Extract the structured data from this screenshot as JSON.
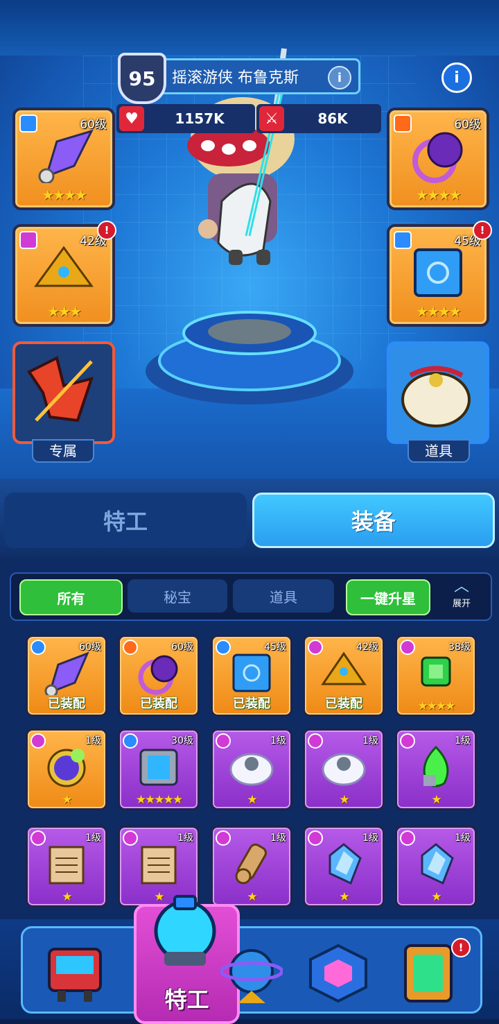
{
  "hero": {
    "level": "95",
    "name": "摇滚游侠 布鲁克斯",
    "info_icon": "i",
    "hp": "1157K",
    "atk": "86K"
  },
  "info_button": "i",
  "slots": {
    "left": [
      {
        "level": "60级",
        "stars": "★★★★",
        "icon": "crystal-sword-icon"
      },
      {
        "level": "42级",
        "stars": "★★★",
        "icon": "golden-pyramid-icon",
        "alert": "!"
      },
      {
        "tag": "专属",
        "icon": "broken-guitar-icon"
      }
    ],
    "right": [
      {
        "level": "60级",
        "stars": "★★★★",
        "icon": "purple-ring-icon"
      },
      {
        "level": "45级",
        "stars": "★★★★",
        "icon": "blue-cube-icon",
        "alert": "!"
      },
      {
        "tag": "道具",
        "icon": "bell-bag-icon"
      }
    ]
  },
  "tabs": {
    "agent": "特工",
    "equipment": "装备"
  },
  "filters": {
    "all": "所有",
    "treasure": "秘宝",
    "items": "道具",
    "upgrade_all": "一键升星",
    "expand": "展开"
  },
  "grid": [
    {
      "level": "60级",
      "status": "已装配",
      "color": "orange",
      "gem": "#2a8cff",
      "icon": "crystal-sword-icon"
    },
    {
      "level": "60级",
      "status": "已装配",
      "color": "orange",
      "gem": "#ff6a1a",
      "icon": "purple-ring-icon"
    },
    {
      "level": "45级",
      "status": "已装配",
      "color": "orange",
      "gem": "#2a8cff",
      "icon": "blue-cube-icon"
    },
    {
      "level": "42级",
      "status": "已装配",
      "color": "orange",
      "gem": "#d23ad6",
      "icon": "golden-pyramid-icon"
    },
    {
      "level": "38级",
      "stars": "★★★★",
      "color": "orange",
      "gem": "#d23ad6",
      "icon": "green-gem-icon"
    },
    {
      "level": "1级",
      "stars": "★",
      "color": "orange",
      "gem": "#d23ad6",
      "icon": "pocket-watch-icon"
    },
    {
      "level": "30级",
      "stars": "★★★★★",
      "color": "purple",
      "gem": "#2a8cff",
      "icon": "blue-frame-icon"
    },
    {
      "level": "1级",
      "stars": "★",
      "color": "purple",
      "gem": "#d23ad6",
      "icon": "fur-ring-icon"
    },
    {
      "level": "1级",
      "stars": "★",
      "color": "purple",
      "gem": "#d23ad6",
      "icon": "fur-ring-icon"
    },
    {
      "level": "1级",
      "stars": "★",
      "color": "purple",
      "gem": "#d23ad6",
      "icon": "green-flame-icon"
    },
    {
      "level": "1级",
      "stars": "★",
      "color": "purple",
      "gem": "#d23ad6",
      "icon": "rune-paper-icon"
    },
    {
      "level": "1级",
      "stars": "★",
      "color": "purple",
      "gem": "#d23ad6",
      "icon": "rune-paper-icon"
    },
    {
      "level": "1级",
      "stars": "★",
      "color": "purple",
      "gem": "#d23ad6",
      "icon": "scroll-icon"
    },
    {
      "level": "1级",
      "stars": "★",
      "color": "purple",
      "gem": "#d23ad6",
      "icon": "crystal-pendant-icon"
    },
    {
      "level": "1级",
      "stars": "★",
      "color": "purple",
      "gem": "#d23ad6",
      "icon": "crystal-pendant-icon"
    }
  ],
  "nav": {
    "active_label": "特工",
    "alert": "!"
  },
  "colors": {
    "accent_green": "#2fbf3a",
    "tab_active": "#38b8ff",
    "orange_card": "#f5a234",
    "purple_card": "#9d43d6"
  }
}
